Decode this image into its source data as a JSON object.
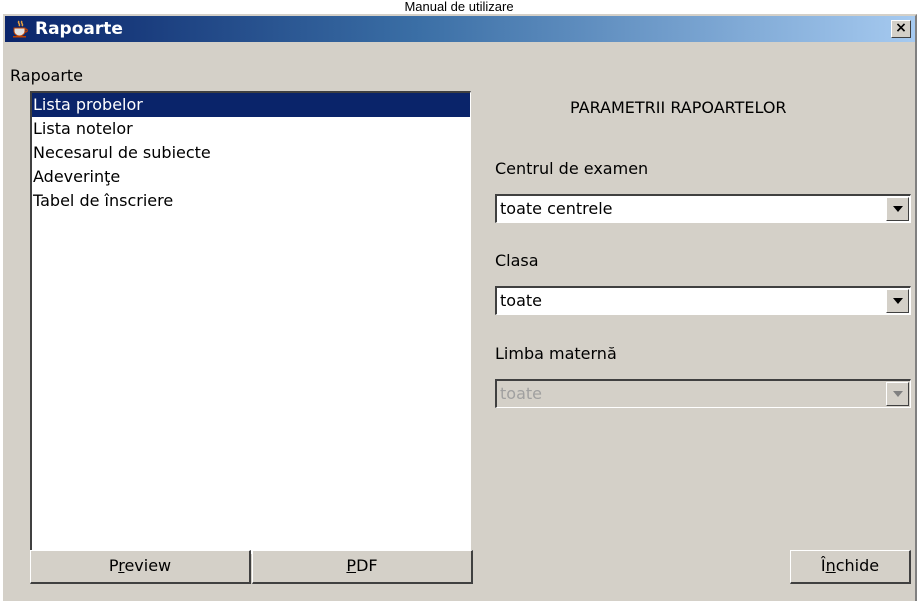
{
  "document": {
    "header": "Manual de utilizare"
  },
  "window": {
    "title": "Rapoarte",
    "close_glyph": "×"
  },
  "reports": {
    "label": "Rapoarte",
    "items": [
      "Lista probelor",
      "Lista notelor",
      "Necesarul de subiecte",
      "Adeverinţe",
      "Tabel de înscriere"
    ],
    "selected_index": 0
  },
  "parameters": {
    "title": "PARAMETRII RAPOARTELOR",
    "centru": {
      "label": "Centrul de examen",
      "value": "toate centrele"
    },
    "clasa": {
      "label": "Clasa",
      "value": "toate"
    },
    "limba": {
      "label": "Limba maternă",
      "value": "toate",
      "disabled": true
    }
  },
  "buttons": {
    "preview": {
      "label": "Preview",
      "mnemonic_index": 1
    },
    "pdf": {
      "label": "PDF",
      "mnemonic_index": 0
    },
    "close": {
      "label": "Închide",
      "mnemonic_index": 1
    }
  },
  "colors": {
    "titlebar_start": "#0a246a",
    "titlebar_end": "#a6caf0",
    "selection": "#0a246a",
    "face": "#d4d0c8"
  },
  "icons": {
    "app": "java-coffee-cup-icon",
    "close": "close-icon",
    "dropdown": "chevron-down-icon"
  }
}
